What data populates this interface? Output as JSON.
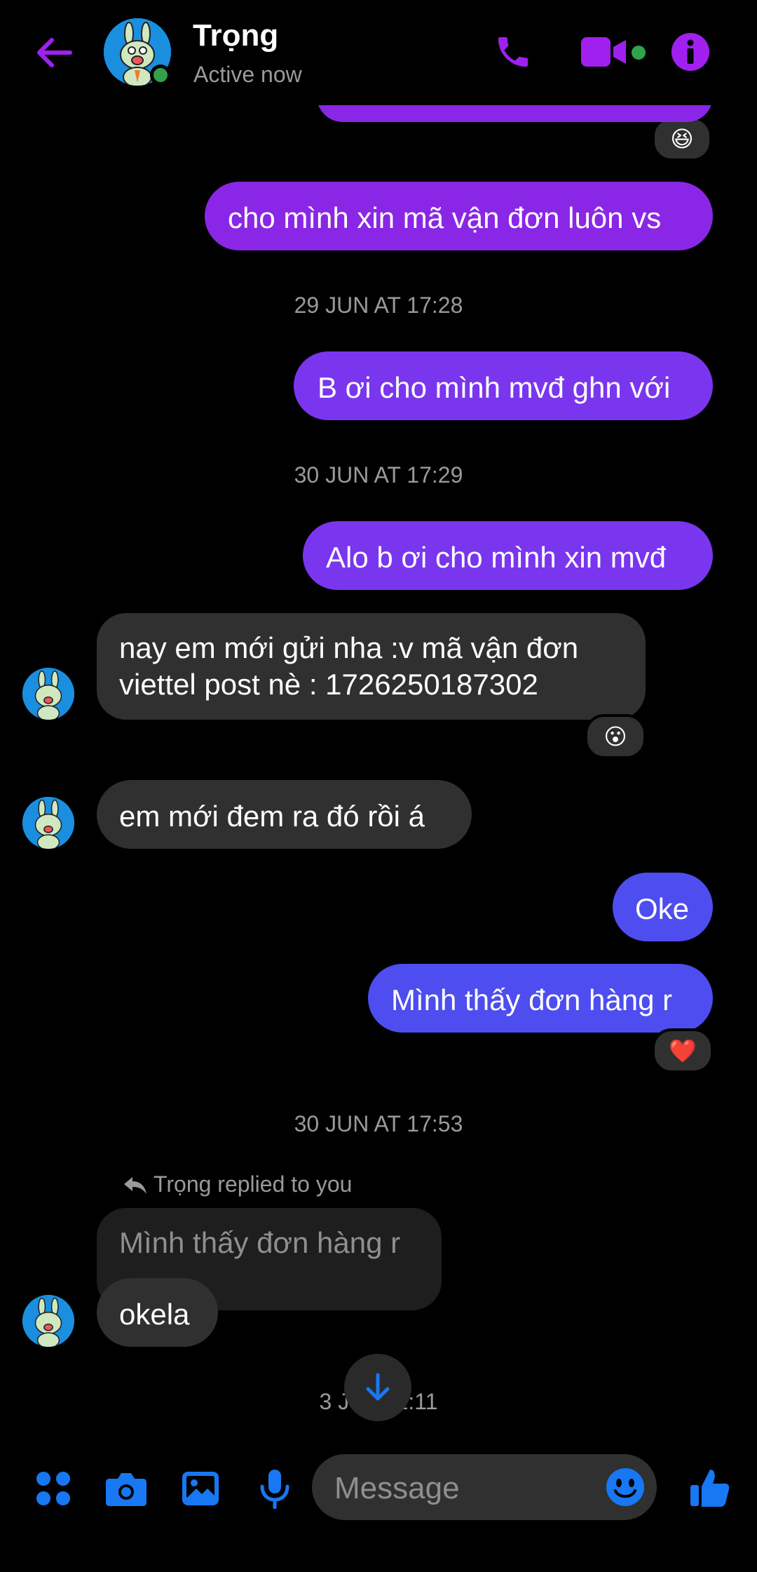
{
  "header": {
    "contact_name": "Trọng",
    "status": "Active now",
    "accent_color": "#a020f0",
    "back_icon": "arrow-left-icon",
    "call_icon": "phone-icon",
    "video_icon": "video-camera-icon",
    "info_icon": "info-icon"
  },
  "messages": {
    "out_1": "cho mình xin mã vận đơn luôn vs",
    "ts_1": "29 JUN AT 17:28",
    "out_2": "B ơi cho mình mvđ ghn với",
    "ts_2": "30 JUN AT 17:29",
    "out_3": "Alo b ơi cho mình xin mvđ",
    "in_1_line1": "nay em mới gửi nha :v mã vận đơn",
    "in_1_line2": "viettel post nè : 1726250187302",
    "in_2": "em mới đem ra đó rồi á",
    "out_4": "Oke",
    "out_5": "Mình thấy đơn hàng r",
    "ts_3": "30 JUN AT 17:53",
    "reply_label": "Trọng replied to you",
    "quoted": "Mình thấy đơn hàng r",
    "in_3": "okela",
    "ts_4": "3 JUL 12:11"
  },
  "reactions": {
    "r1": "😆",
    "r2": "😮",
    "r3": "❤️"
  },
  "composer": {
    "placeholder": "Message",
    "accent_color": "#1877f2"
  }
}
